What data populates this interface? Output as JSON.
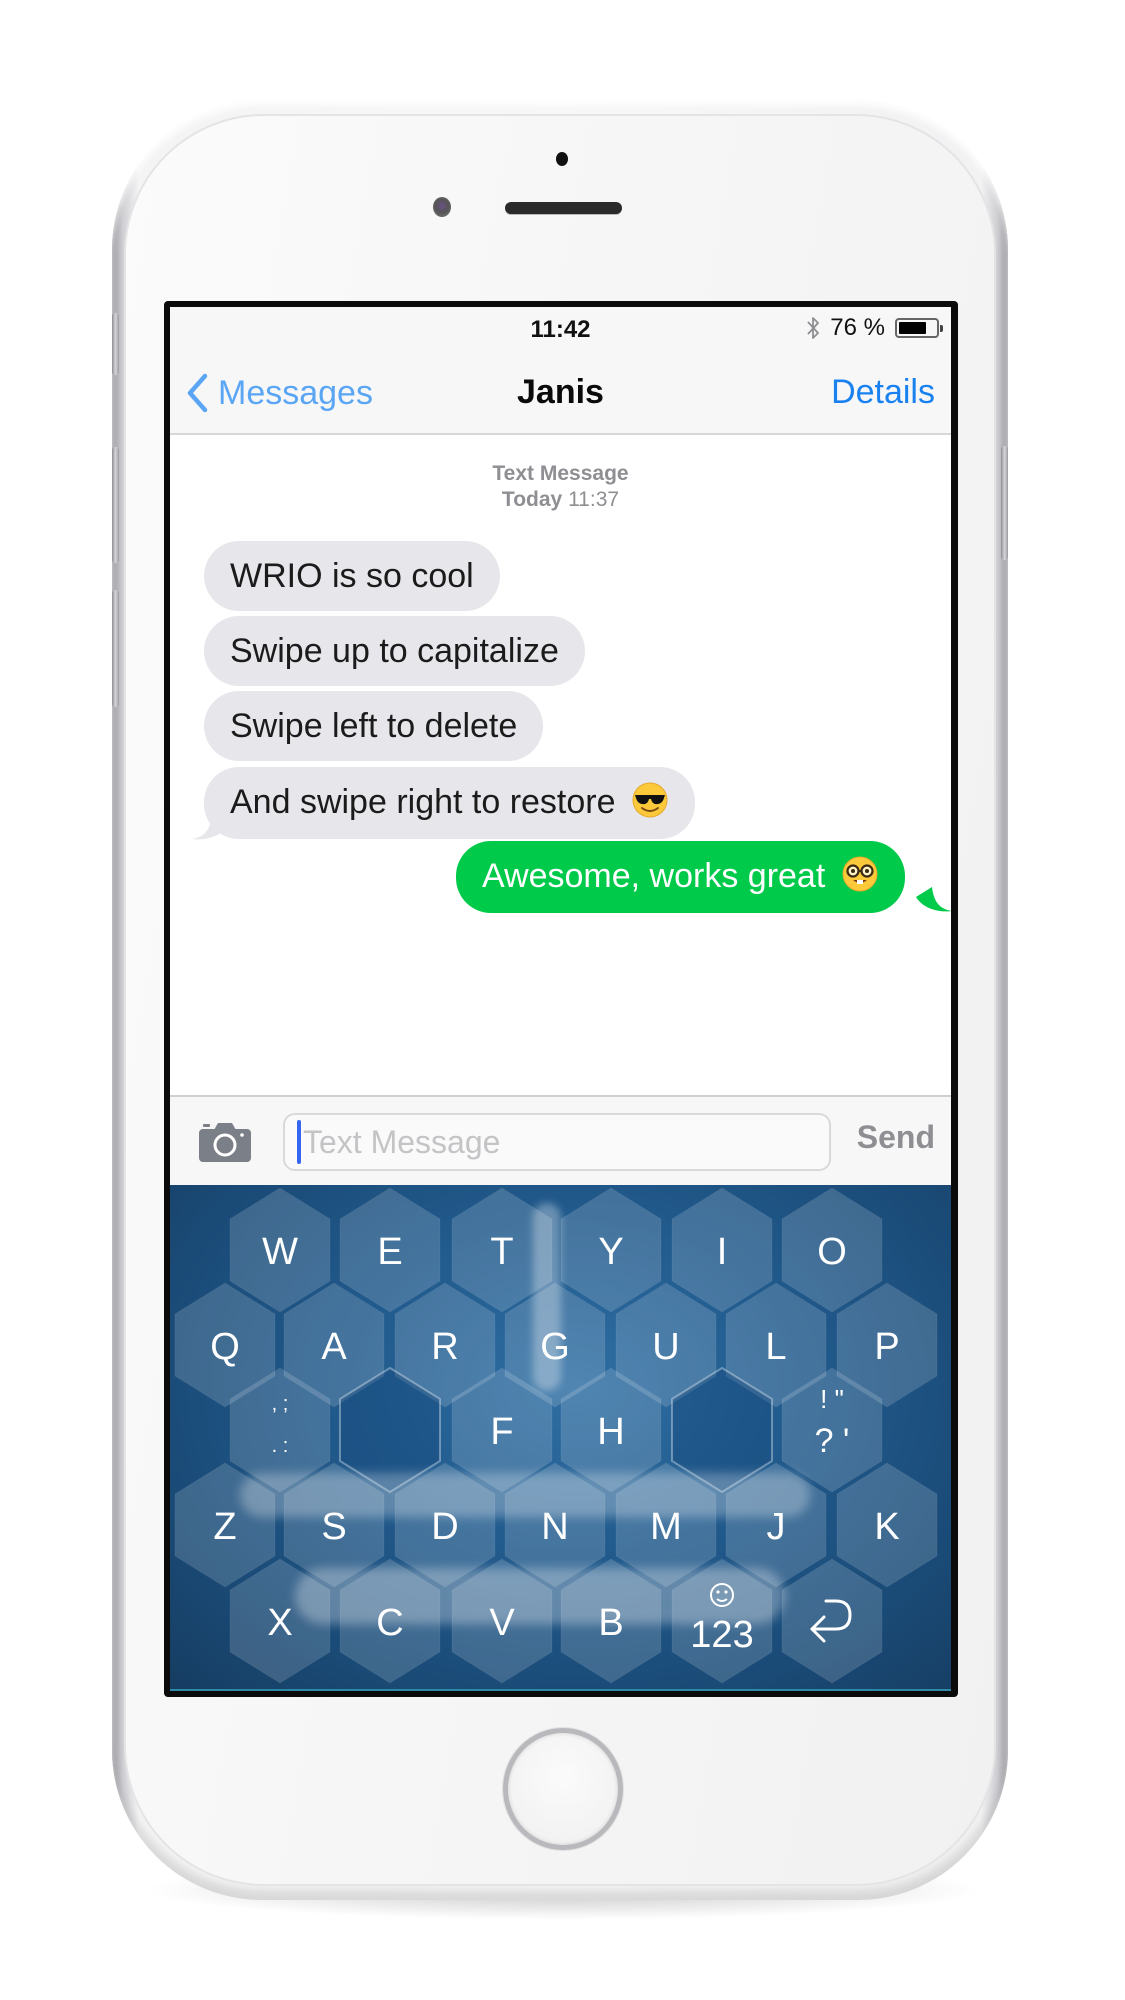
{
  "status_bar": {
    "time": "11:42",
    "bluetooth_icon": "bluetooth-icon",
    "battery_percent_label": "76 %",
    "battery_level": 0.76
  },
  "nav_bar": {
    "back_label": "Messages",
    "back_icon": "chevron-left-icon",
    "title": "Janis",
    "details_label": "Details"
  },
  "conversation": {
    "header_kind": "Text Message",
    "header_day": "Today",
    "header_time": "11:37",
    "messages": [
      {
        "direction": "incoming",
        "text": "WRIO is so cool",
        "emoji": ""
      },
      {
        "direction": "incoming",
        "text": "Swipe up to capitalize",
        "emoji": ""
      },
      {
        "direction": "incoming",
        "text": "Swipe left to delete",
        "emoji": ""
      },
      {
        "direction": "incoming",
        "text": "And swipe right to restore",
        "emoji": "sunglasses-emoji"
      },
      {
        "direction": "outgoing",
        "text": "Awesome, works great",
        "emoji": "nerd-face-emoji"
      }
    ]
  },
  "input_bar": {
    "camera_icon": "camera-icon",
    "placeholder": "Text Message",
    "value": "",
    "send_label": "Send"
  },
  "keyboard": {
    "layout": "WRIO hexagonal",
    "rows": [
      [
        "W",
        "E",
        "T",
        "Y",
        "I",
        "O"
      ],
      [
        "Q",
        "A",
        "R",
        "G",
        "U",
        "L",
        "P"
      ],
      [
        ", ; . :",
        "",
        "F",
        "H",
        "",
        "! \" ? '"
      ],
      [
        "Z",
        "S",
        "D",
        "N",
        "M",
        "J",
        "K"
      ],
      [
        "X",
        "C",
        "V",
        "B",
        "123",
        "return"
      ]
    ],
    "punct_left": {
      "top": ", ;",
      "bottom": ". :"
    },
    "punct_right": {
      "top": "! \"",
      "bottom": "? '"
    },
    "emoji_key_icon": "smiley-icon",
    "numbers_label": "123",
    "return_icon": "return-arrow-icon",
    "gestures": [
      "swipe-up",
      "swipe-left",
      "swipe-right"
    ],
    "colors": {
      "background": "#215a8c",
      "key_fill": "#ffffff",
      "trail": "#ffffff"
    }
  },
  "colors": {
    "accent_blue": "#1a82f0",
    "outgoing_bubble": "#00ca4a",
    "incoming_bubble": "#e6e6eb",
    "caret": "#3666f0"
  }
}
